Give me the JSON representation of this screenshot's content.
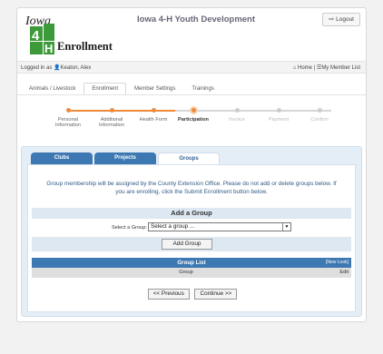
{
  "header": {
    "logo_top": "Iowa",
    "logo_word": "Enrollment",
    "site_title": "Iowa 4-H Youth Development",
    "logout_label": "Logout",
    "logout_icon": "sign-out-icon"
  },
  "userbar": {
    "logged_in_label": "Logged in as",
    "user_name": "Keaton, Alex",
    "home_label": "Home",
    "separator": "|",
    "member_list_label": "My Member List"
  },
  "main_tabs": [
    {
      "label": "Animals / Livestock",
      "active": false
    },
    {
      "label": "Enrollment",
      "active": true
    },
    {
      "label": "Member Settings",
      "active": false
    },
    {
      "label": "Trainings",
      "active": false
    }
  ],
  "progress_steps": [
    {
      "line1": "Personal",
      "line2": "Information",
      "state": "done"
    },
    {
      "line1": "Additional",
      "line2": "Information",
      "state": "done"
    },
    {
      "line1": "Health Form",
      "line2": "",
      "state": "done"
    },
    {
      "line1": "Participation",
      "line2": "",
      "state": "current"
    },
    {
      "line1": "Invoice",
      "line2": "",
      "state": "todo"
    },
    {
      "line1": "Payment",
      "line2": "",
      "state": "todo"
    },
    {
      "line1": "Confirm",
      "line2": "",
      "state": "todo"
    }
  ],
  "sub_tabs": [
    {
      "label": "Clubs",
      "active": false
    },
    {
      "label": "Projects",
      "active": false
    },
    {
      "label": "Groups",
      "active": true
    }
  ],
  "groups": {
    "notice_line1": "Group membership will be assigned by the County Extension Office. Please do not add or delete groups below. If",
    "notice_line2": "you are enrolling, click the Submit Enrollment button below.",
    "add_heading": "Add a Group",
    "select_label": "Select a Group:",
    "select_value": "Select a group ...",
    "add_button": "Add Group",
    "list_title": "Group List",
    "new_look": "[New Look]",
    "col_group": "Group",
    "col_edit": "Edit"
  },
  "nav": {
    "previous": "<< Previous",
    "continue": "Continue >>"
  },
  "colors": {
    "accent_orange": "#ef8a3a",
    "tab_blue": "#3d78b2",
    "logo_green": "#3d9a3a"
  }
}
